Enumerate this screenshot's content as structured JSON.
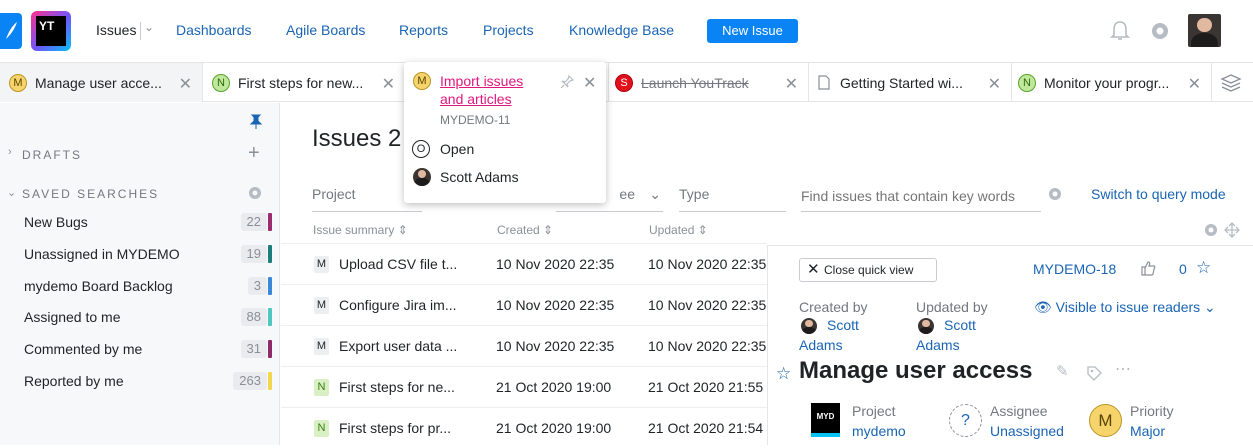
{
  "nav": {
    "issues": "Issues",
    "dashboards": "Dashboards",
    "agile": "Agile Boards",
    "reports": "Reports",
    "projects": "Projects",
    "kb": "Knowledge Base",
    "new_issue": "New Issue",
    "logo": "YT"
  },
  "tabs": [
    {
      "badge": "M",
      "title": "Manage user acce..."
    },
    {
      "badge": "N",
      "title": "First steps for new..."
    },
    {
      "badge": "M",
      "title": ""
    },
    {
      "badge": "S",
      "title": "Launch YouTrack"
    },
    {
      "badge": "",
      "title": "Getting Started wi..."
    },
    {
      "badge": "N",
      "title": "Monitor your progr..."
    }
  ],
  "popup": {
    "title": "Import issues and articles",
    "id": "MYDEMO-11",
    "state_badge": "O",
    "state": "Open",
    "assignee": "Scott Adams"
  },
  "sidebar": {
    "drafts": "DRAFTS",
    "saved": "SAVED SEARCHES",
    "items": [
      {
        "label": "New Bugs",
        "count": "22",
        "color": "#9b2c6e"
      },
      {
        "label": "Unassigned in MYDEMO",
        "count": "19",
        "color": "#1e7d7a"
      },
      {
        "label": "mydemo Board Backlog",
        "count": "3",
        "color": "#3b86d8"
      },
      {
        "label": "Assigned to me",
        "count": "88",
        "color": "#4ec7c0"
      },
      {
        "label": "Commented by me",
        "count": "31",
        "color": "#8f2a68"
      },
      {
        "label": "Reported by me",
        "count": "263",
        "color": "#f2d64b"
      }
    ]
  },
  "main": {
    "heading": "Issues 2",
    "filters": {
      "project": "Project",
      "assignee_partial": "ee",
      "type": "Type",
      "search_placeholder": "Find issues that contain key words",
      "switch": "Switch to query mode"
    },
    "columns": {
      "summary": "Issue summary",
      "created": "Created",
      "updated": "Updated"
    },
    "rows": [
      {
        "badge": "M",
        "summary": "Upload CSV file t...",
        "created": "10 Nov 2020 22:35",
        "updated": "10 Nov 2020 22:35"
      },
      {
        "badge": "M",
        "summary": "Configure Jira im...",
        "created": "10 Nov 2020 22:35",
        "updated": "10 Nov 2020 22:35"
      },
      {
        "badge": "M",
        "summary": "Export user data ...",
        "created": "10 Nov 2020 22:35",
        "updated": "10 Nov 2020 22:35"
      },
      {
        "badge": "N",
        "summary": "First steps for ne...",
        "created": "21 Oct 2020 19:00",
        "updated": "21 Oct 2020 21:55"
      },
      {
        "badge": "N",
        "summary": "First steps for pr...",
        "created": "21 Oct 2020 19:00",
        "updated": "21 Oct 2020 21:54"
      }
    ]
  },
  "quickview": {
    "close": "Close quick view",
    "id": "MYDEMO-18",
    "votes": "0",
    "created_by_label": "Created by",
    "created_by_first": "Scott",
    "created_by_last": "Adams",
    "updated_by_label": "Updated by",
    "updated_by_first": "Scott",
    "updated_by_last": "Adams",
    "visibility": "Visible to issue readers",
    "title": "Manage user access",
    "project_label": "Project",
    "project_value": "mydemo",
    "project_logo": "MYD",
    "assignee_label": "Assignee",
    "assignee_value": "Unassigned",
    "priority_label": "Priority",
    "priority_value": "Major",
    "priority_badge": "M"
  }
}
